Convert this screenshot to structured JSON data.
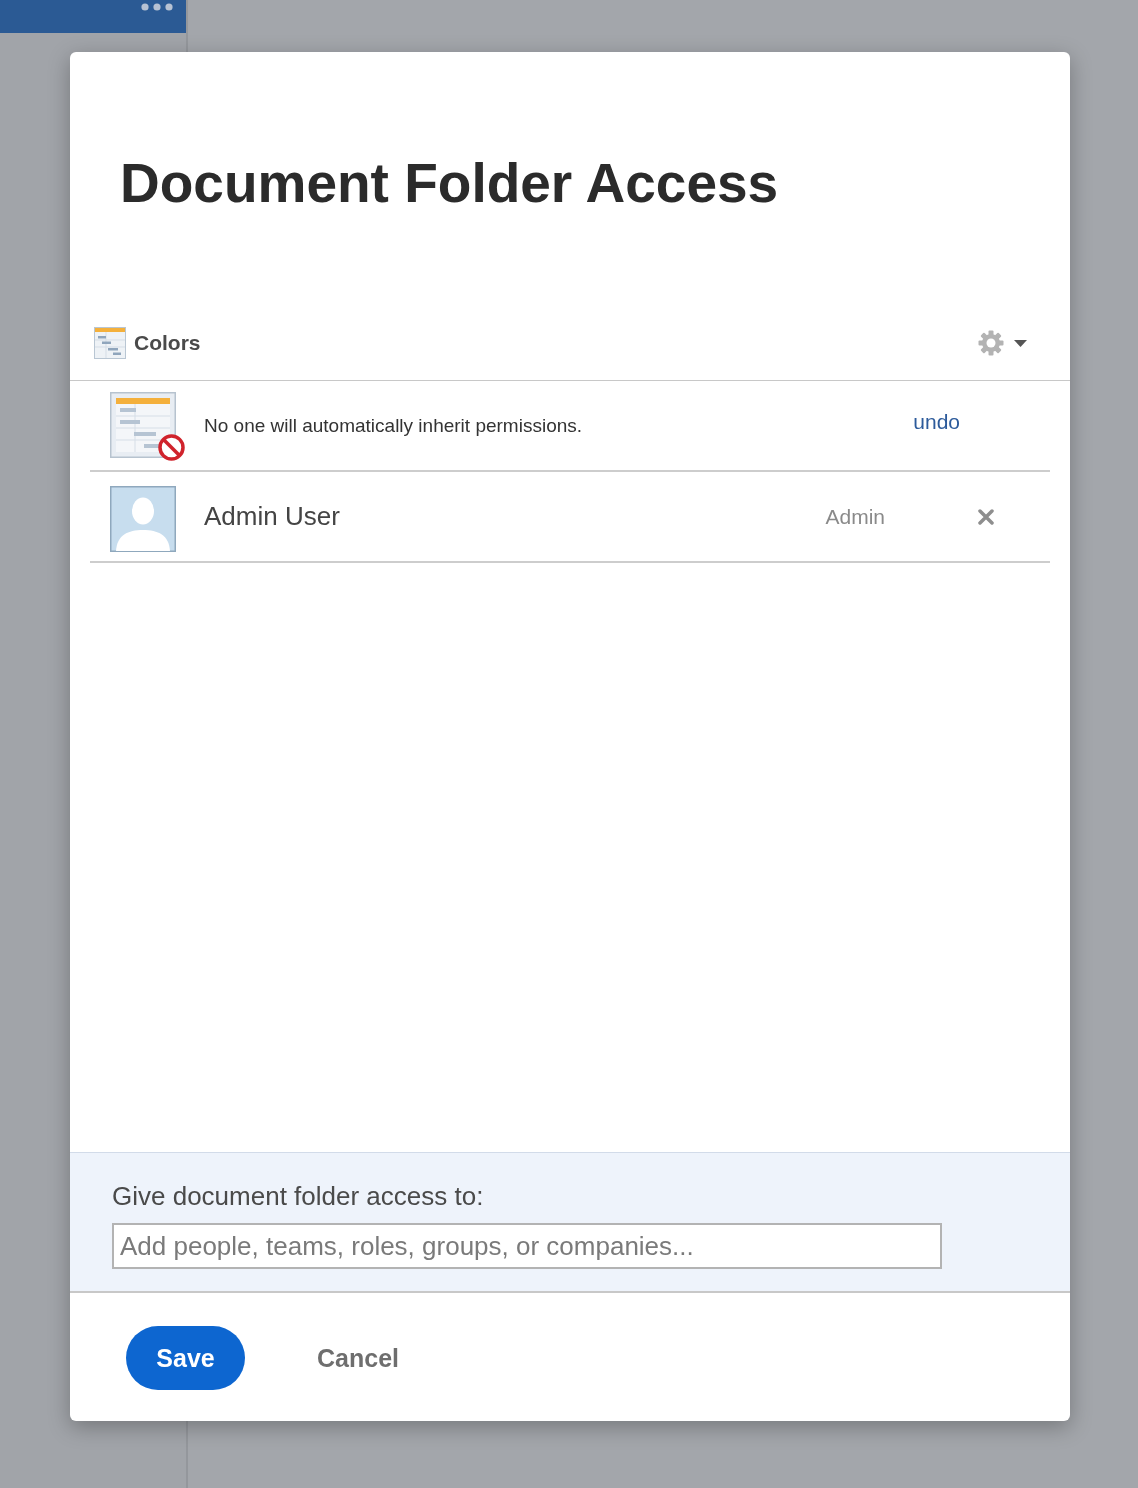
{
  "dialog": {
    "title": "Document Folder Access"
  },
  "folder": {
    "name": "Colors"
  },
  "inherit_notice": {
    "text": "No one will automatically inherit permissions.",
    "action": "undo"
  },
  "members": [
    {
      "name": "Admin User",
      "role": "Admin"
    }
  ],
  "share": {
    "label": "Give document folder access to:",
    "placeholder": "Add people, teams, roles, groups, or companies..."
  },
  "buttons": [
    {
      "label": "Save",
      "kind": "primary"
    },
    {
      "label": "Cancel",
      "kind": "secondary"
    }
  ]
}
